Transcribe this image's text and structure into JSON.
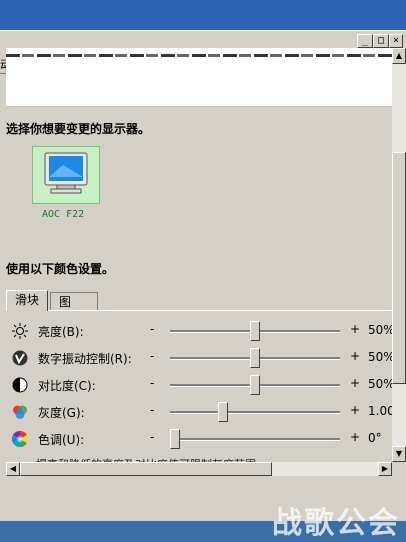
{
  "menu": {
    "item_partial": "动(H)"
  },
  "window_buttons": {
    "minimize": "_",
    "maximize": "□",
    "close": "×"
  },
  "sections": {
    "choose_display": "选择你想要变更的显示器。",
    "use_colors": "使用以下颜色设置。"
  },
  "monitor": {
    "label": "AOC F22"
  },
  "tabs": [
    {
      "label": "滑块"
    },
    {
      "label": "图"
    }
  ],
  "sliders": [
    {
      "label": "亮度(B):",
      "icon": "sun-icon",
      "minus": "-",
      "plus": "+",
      "value": "50%",
      "position": 0.5
    },
    {
      "label": "数字振动控制(R):",
      "icon": "vibrance-icon",
      "minus": "-",
      "plus": "+",
      "value": "50%",
      "position": 0.5
    },
    {
      "label": "对比度(C):",
      "icon": "contrast-icon",
      "minus": "-",
      "plus": "+",
      "value": "50%",
      "position": 0.5
    },
    {
      "label": "灰度(G):",
      "icon": "gamma-icon",
      "minus": "-",
      "plus": "+",
      "value": "1.00",
      "position": 0.3
    },
    {
      "label": "色调(U):",
      "icon": "hue-icon",
      "minus": "-",
      "plus": "+",
      "value": "0°",
      "position": 0.0
    }
  ],
  "footnote": "提高和降低的亮度及对比度值可限制灰度范围。",
  "watermark": "战歌公会",
  "colors": {
    "desktop": "#3a6ea5",
    "window": "#d4d0c8",
    "monitor_label": "#1a7a1a"
  }
}
